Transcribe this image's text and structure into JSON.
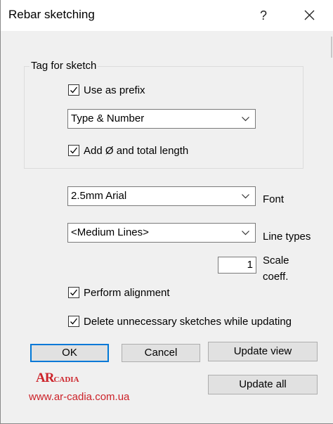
{
  "window": {
    "title": "Rebar sketching",
    "help_label": "?"
  },
  "tag_group": {
    "label": "Tag for sketch",
    "use_prefix": {
      "label": "Use as prefix",
      "checked": true
    },
    "tag_type": {
      "value": "Type & Number"
    },
    "add_length": {
      "label": "Add Ø and total length",
      "checked": true
    }
  },
  "font": {
    "value": "2.5mm Arial",
    "label": "Font"
  },
  "line_types": {
    "value": "<Medium Lines>",
    "label": "Line types"
  },
  "scale": {
    "value": "1",
    "label_line1": "Scale",
    "label_line2": "coeff."
  },
  "perform_alignment": {
    "label": "Perform alignment",
    "checked": true
  },
  "delete_sketches": {
    "label": "Delete unnecessary sketches while updating",
    "checked": true
  },
  "buttons": {
    "ok": "OK",
    "cancel": "Cancel",
    "update_view": "Update view",
    "update_all": "Update all"
  },
  "brand": {
    "logo_ar": "AR",
    "logo_cadia": "CADIA",
    "website": "www.ar-cadia.com.ua",
    "color": "#cc2229"
  },
  "colors": {
    "accent": "#0078d7",
    "dialog_bg": "#f0f0f0"
  }
}
